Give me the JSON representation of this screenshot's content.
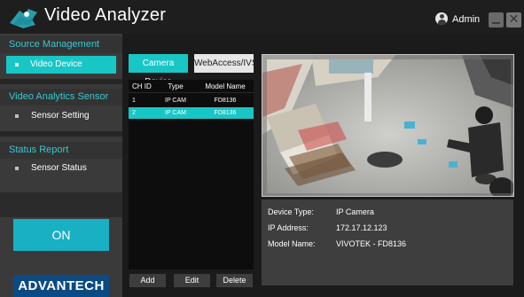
{
  "app": {
    "title": "Video Analyzer",
    "user": "Admin",
    "close_glyph": "✕"
  },
  "sidebar": {
    "sections": [
      {
        "header": "Source Management",
        "items": [
          {
            "label": "Video Device",
            "active": true
          }
        ]
      },
      {
        "header": "Video Analytics Sensor",
        "items": [
          {
            "label": "Sensor Setting",
            "active": false
          }
        ]
      },
      {
        "header": "Status Report",
        "items": [
          {
            "label": "Sensor Status",
            "active": false
          }
        ]
      }
    ],
    "power_button": "ON",
    "brand": "ADVANTECH"
  },
  "device_tabs": [
    {
      "label": "Camera Device",
      "active": true
    },
    {
      "label": "WebAccess/IVS",
      "active": false
    }
  ],
  "device_table": {
    "columns": [
      "CH ID",
      "Type",
      "Model Name"
    ],
    "rows": [
      {
        "ch": "1",
        "type": "IP CAM",
        "model": "FD8136",
        "selected": false
      },
      {
        "ch": "2",
        "type": "IP CAM",
        "model": "FD8136",
        "selected": true
      }
    ]
  },
  "actions": {
    "add": "Add",
    "edit": "Edit",
    "delete": "Delete"
  },
  "device_info": {
    "labels": [
      "Device Type:",
      "IP Address:",
      "Model Name:"
    ],
    "values": [
      "IP Camera",
      "172.17.12.123",
      "VIVOTEK - FD8136"
    ]
  },
  "colors": {
    "accent": "#19c6c6",
    "on_button": "#19b0c4",
    "brand": "#0b4a83"
  },
  "icons": {
    "logo": "camera-logo-icon",
    "user": "user-avatar-icon",
    "minimize": "minimize-icon",
    "close": "close-icon"
  }
}
